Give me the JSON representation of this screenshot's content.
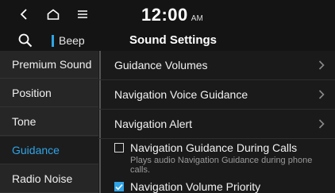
{
  "statusbar": {
    "time": "12:00",
    "ampm": "AM",
    "icons": [
      "back-icon",
      "home-icon",
      "menu-icon"
    ]
  },
  "header": {
    "search_icon": "search-icon",
    "beep_label": "Beep",
    "title": "Sound Settings"
  },
  "sidebar": {
    "items": [
      {
        "label": "Premium Sound",
        "active": false
      },
      {
        "label": "Position",
        "active": false
      },
      {
        "label": "Tone",
        "active": false
      },
      {
        "label": "Guidance",
        "active": true
      },
      {
        "label": "Radio Noise",
        "active": false
      }
    ]
  },
  "main": {
    "rows": [
      {
        "label": "Guidance Volumes"
      },
      {
        "label": "Navigation Voice Guidance"
      },
      {
        "label": "Navigation Alert"
      }
    ],
    "checks": [
      {
        "label": "Navigation Guidance During Calls",
        "description": "Plays audio Navigation Guidance during phone calls.",
        "checked": false
      },
      {
        "label": "Navigation Volume Priority",
        "checked": true
      }
    ]
  },
  "colors": {
    "accent": "#2fa4e7",
    "background": "#141414",
    "sidebar": "#262626"
  }
}
